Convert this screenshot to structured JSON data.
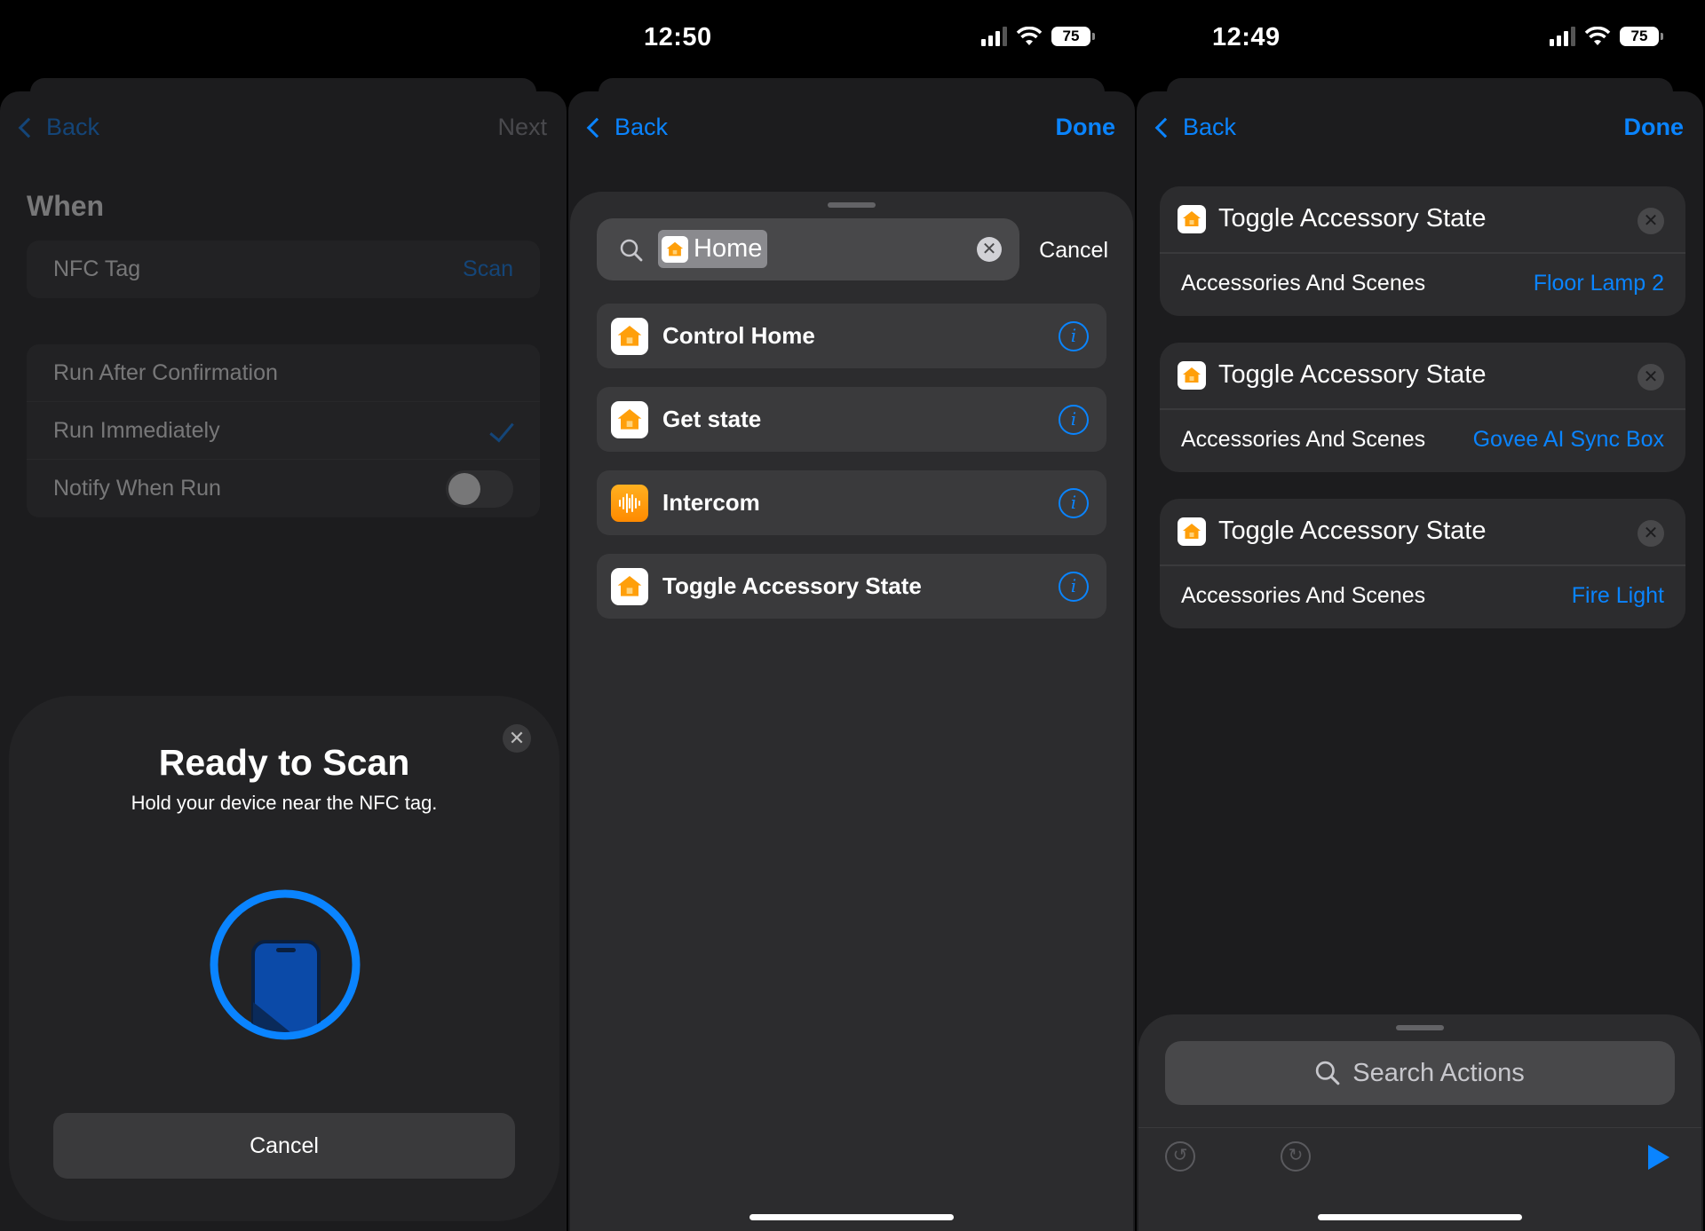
{
  "panel1": {
    "status": {
      "time": "",
      "battery": ""
    },
    "nav": {
      "back": "Back",
      "next": "Next"
    },
    "when_title": "When",
    "trigger": {
      "label": "NFC Tag",
      "action": "Scan"
    },
    "options": [
      {
        "label": "Run After Confirmation"
      },
      {
        "label": "Run Immediately",
        "checked": true
      },
      {
        "label": "Notify When Run",
        "toggle": false
      }
    ],
    "scan_sheet": {
      "title": "Ready to Scan",
      "subtitle": "Hold your device near the NFC tag.",
      "cancel": "Cancel"
    }
  },
  "panel2": {
    "status": {
      "time": "12:50",
      "battery": "75"
    },
    "nav": {
      "back": "Back",
      "done": "Done"
    },
    "search": {
      "token": "Home",
      "cancel": "Cancel"
    },
    "results": [
      {
        "label": "Control Home",
        "icon": "home-app-icon"
      },
      {
        "label": "Get state",
        "icon": "home-app-icon"
      },
      {
        "label": "Intercom",
        "icon": "intercom-waveform-icon"
      },
      {
        "label": "Toggle Accessory State",
        "icon": "home-app-icon"
      }
    ]
  },
  "panel3": {
    "status": {
      "time": "12:49",
      "battery": "75"
    },
    "nav": {
      "back": "Back",
      "done": "Done"
    },
    "actions": [
      {
        "title": "Toggle Accessory State",
        "param": "Accessories And Scenes",
        "value": "Floor Lamp 2"
      },
      {
        "title": "Toggle Accessory State",
        "param": "Accessories And Scenes",
        "value": "Govee AI Sync Box"
      },
      {
        "title": "Toggle Accessory State",
        "param": "Accessories And Scenes",
        "value": "Fire Light"
      }
    ],
    "search_actions": "Search Actions"
  },
  "colors": {
    "accent": "#0a84ff",
    "background": "#000000",
    "card": "#2c2c2e",
    "home_orange": "#ff9f0a"
  }
}
